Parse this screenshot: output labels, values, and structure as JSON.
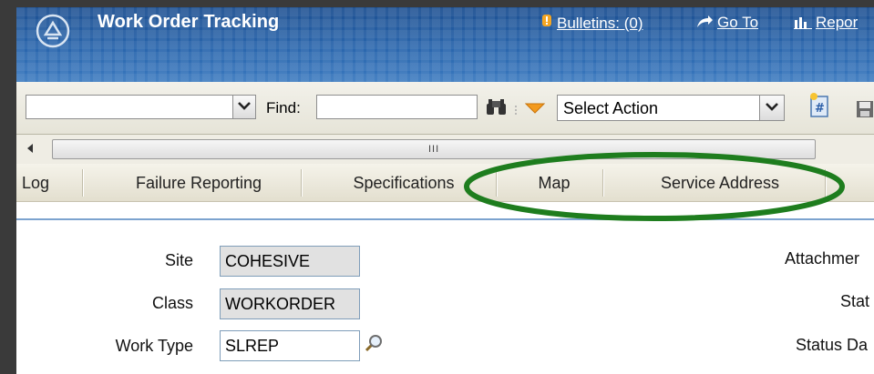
{
  "header": {
    "app_title": "Work Order Tracking",
    "bulletins": "Bulletins: (0)",
    "goto": "Go To",
    "reports": "Repor"
  },
  "toolbar": {
    "find_label": "Find:",
    "find_value": "",
    "select_action": "Select Action"
  },
  "scrollbar": {
    "grip": "III"
  },
  "tabs": [
    {
      "label": "Log"
    },
    {
      "label": "Failure Reporting"
    },
    {
      "label": "Specifications"
    },
    {
      "label": "Map"
    },
    {
      "label": "Service Address"
    }
  ],
  "form": {
    "site_label": "Site",
    "site_value": "COHESIVE",
    "class_label": "Class",
    "class_value": "WORKORDER",
    "worktype_label": "Work Type",
    "worktype_value": "SLREP",
    "attachments_label": "Attachmer",
    "status_label": "Stat",
    "status_date_label": "Status Da"
  },
  "annotation": {
    "color": "#1e7d1e"
  },
  "colors": {
    "header": "#2a66ad",
    "tab_bg": "#e3dfcf"
  }
}
